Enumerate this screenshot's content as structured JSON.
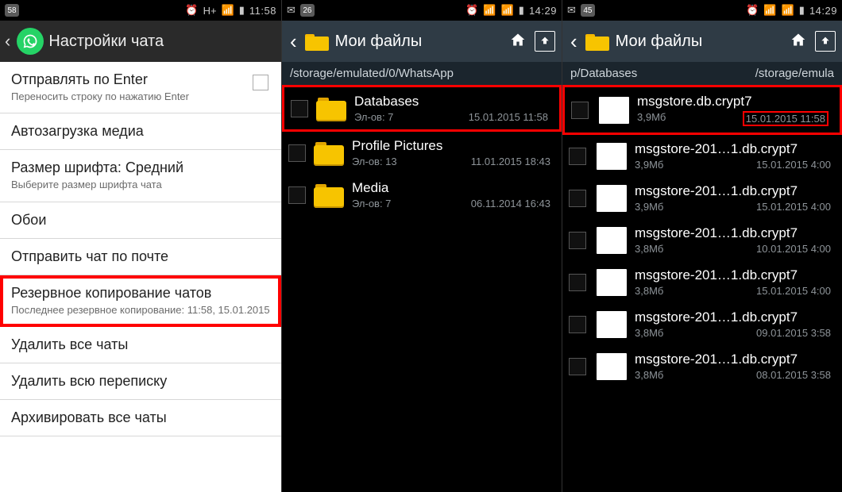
{
  "screens": {
    "s1": {
      "status": {
        "badge": "58",
        "net": "H+",
        "time": "11:58"
      },
      "title": "Настройки чата",
      "items": [
        {
          "t": "Отправлять по Enter",
          "s": "Переносить строку по нажатию Enter",
          "checkbox": true
        },
        {
          "t": "Автозагрузка медиа"
        },
        {
          "t": "Размер шрифта: Средний",
          "s": "Выберите размер шрифта чата"
        },
        {
          "t": "Обои"
        },
        {
          "t": "Отправить чат по почте"
        },
        {
          "t": "Резервное копирование чатов",
          "s": "Последнее резервное копирование: 11:58, 15.01.2015",
          "highlight": true
        },
        {
          "t": "Удалить все чаты"
        },
        {
          "t": "Удалить всю переписку"
        },
        {
          "t": "Архивировать все чаты"
        }
      ]
    },
    "s2": {
      "status": {
        "badge": "26",
        "time": "14:29"
      },
      "title": "Мои файлы",
      "path": "/storage/emulated/0/WhatsApp",
      "files": [
        {
          "name": "Databases",
          "type": "folder",
          "subL": "Эл-ов: 7",
          "subR": "15.01.2015 11:58",
          "highlight": true
        },
        {
          "name": "Profile Pictures",
          "type": "folder",
          "subL": "Эл-ов: 13",
          "subR": "11.01.2015 18:43"
        },
        {
          "name": "Media",
          "type": "folder",
          "subL": "Эл-ов: 7",
          "subR": "06.11.2014 16:43"
        }
      ]
    },
    "s3": {
      "status": {
        "badge": "45",
        "time": "14:29"
      },
      "title": "Мои файлы",
      "pathL": "p/Databases",
      "pathR": "/storage/emula",
      "files": [
        {
          "name": "msgstore.db.crypt7",
          "type": "file",
          "subL": "3,9Мб",
          "subR": "15.01.2015 11:58",
          "highlight": true,
          "dateBox": true
        },
        {
          "name": "msgstore-201…1.db.crypt7",
          "type": "file",
          "subL": "3,9Мб",
          "subR": "15.01.2015 4:00"
        },
        {
          "name": "msgstore-201…1.db.crypt7",
          "type": "file",
          "subL": "3,9Мб",
          "subR": "15.01.2015 4:00"
        },
        {
          "name": "msgstore-201…1.db.crypt7",
          "type": "file",
          "subL": "3,8Мб",
          "subR": "10.01.2015 4:00"
        },
        {
          "name": "msgstore-201…1.db.crypt7",
          "type": "file",
          "subL": "3,8Мб",
          "subR": "15.01.2015 4:00"
        },
        {
          "name": "msgstore-201…1.db.crypt7",
          "type": "file",
          "subL": "3,8Мб",
          "subR": "09.01.2015 3:58"
        },
        {
          "name": "msgstore-201…1.db.crypt7",
          "type": "file",
          "subL": "3,8Мб",
          "subR": "08.01.2015 3:58"
        }
      ]
    }
  }
}
